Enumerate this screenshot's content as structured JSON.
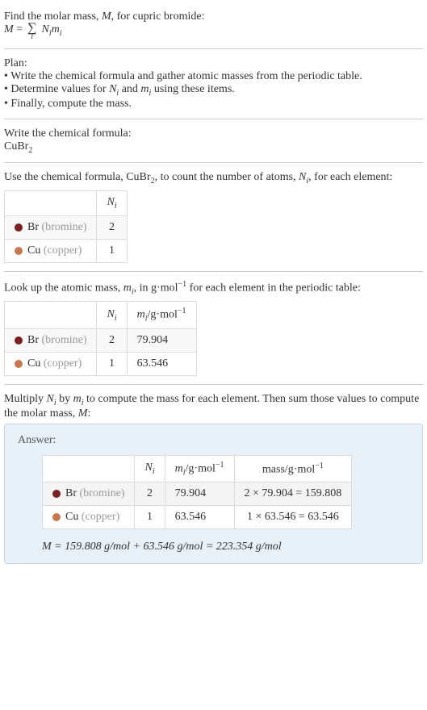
{
  "intro": {
    "line1": "Find the molar mass, ",
    "var_M": "M",
    "line1_end": ", for cupric bromide:",
    "formula_M": "M",
    "formula_eq": " = ",
    "formula_Ni": "N",
    "formula_Ni_sub": "i",
    "formula_mi": "m",
    "formula_mi_sub": "i",
    "sigma_sub": "i"
  },
  "plan": {
    "title": "Plan:",
    "bullet1": "• Write the chemical formula and gather atomic masses from the periodic table.",
    "bullet2_start": "• Determine values for ",
    "bullet2_Ni": "N",
    "bullet2_Ni_sub": "i",
    "bullet2_and": " and ",
    "bullet2_mi": "m",
    "bullet2_mi_sub": "i",
    "bullet2_end": " using these items.",
    "bullet3": "• Finally, compute the mass."
  },
  "formula_section": {
    "title": "Write the chemical formula:",
    "formula": "CuBr",
    "formula_sub": "2"
  },
  "count_section": {
    "text1": "Use the chemical formula, CuBr",
    "text1_sub": "2",
    "text2": ", to count the number of atoms, ",
    "var_Ni": "N",
    "var_Ni_sub": "i",
    "text3": ", for each element:",
    "table": {
      "header_Ni": "N",
      "header_Ni_sub": "i",
      "rows": [
        {
          "element": "Br",
          "name": "(bromine)",
          "ni": "2"
        },
        {
          "element": "Cu",
          "name": "(copper)",
          "ni": "1"
        }
      ]
    }
  },
  "mass_section": {
    "text1": "Look up the atomic mass, ",
    "var_mi": "m",
    "var_mi_sub": "i",
    "text2": ", in g·mol",
    "text2_sup": "−1",
    "text3": " for each element in the periodic table:",
    "table": {
      "header_Ni": "N",
      "header_Ni_sub": "i",
      "header_mi": "m",
      "header_mi_sub": "i",
      "header_unit": "/g·mol",
      "header_unit_sup": "−1",
      "rows": [
        {
          "element": "Br",
          "name": "(bromine)",
          "ni": "2",
          "mi": "79.904"
        },
        {
          "element": "Cu",
          "name": "(copper)",
          "ni": "1",
          "mi": "63.546"
        }
      ]
    }
  },
  "multiply_section": {
    "text1": "Multiply ",
    "var_Ni": "N",
    "var_Ni_sub": "i",
    "text2": " by ",
    "var_mi": "m",
    "var_mi_sub": "i",
    "text3": " to compute the mass for each element. Then sum those values to compute the molar mass, ",
    "var_M": "M",
    "text4": ":"
  },
  "answer": {
    "label": "Answer:",
    "table": {
      "header_Ni": "N",
      "header_Ni_sub": "i",
      "header_mi": "m",
      "header_mi_sub": "i",
      "header_unit": "/g·mol",
      "header_unit_sup": "−1",
      "header_mass": "mass/g·mol",
      "header_mass_sup": "−1",
      "rows": [
        {
          "element": "Br",
          "name": "(bromine)",
          "ni": "2",
          "mi": "79.904",
          "mass": "2 × 79.904 = 159.808"
        },
        {
          "element": "Cu",
          "name": "(copper)",
          "ni": "1",
          "mi": "63.546",
          "mass": "1 × 63.546 = 63.546"
        }
      ]
    },
    "final_M": "M",
    "final_eq": " = 159.808 g/mol + 63.546 g/mol = 223.354 g/mol"
  }
}
